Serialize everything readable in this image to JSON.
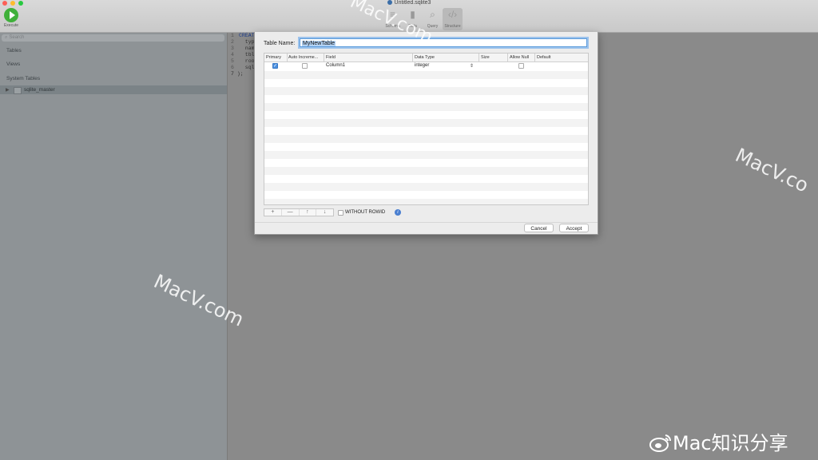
{
  "window": {
    "title": "Untitled.sqlite3"
  },
  "toolbar": {
    "execute_label": "Execute",
    "buttons": [
      {
        "label": "Schema",
        "icon": "schema-icon"
      },
      {
        "label": "Data",
        "icon": "bar-chart-icon"
      },
      {
        "label": "Query",
        "icon": "magnifier-icon"
      },
      {
        "label": "Structure",
        "icon": "code-brackets-icon"
      }
    ],
    "active": "Structure"
  },
  "sidebar": {
    "search_placeholder": "Search",
    "sections": [
      "Tables",
      "Views",
      "System Tables"
    ],
    "items": [
      {
        "name": "sqlite_master",
        "expanded": false
      }
    ]
  },
  "editor": {
    "lines": [
      {
        "n": "1",
        "text": "CREAT"
      },
      {
        "n": "2",
        "text": "  typ"
      },
      {
        "n": "3",
        "text": "  nam"
      },
      {
        "n": "4",
        "text": "  tbl"
      },
      {
        "n": "5",
        "text": "  roo"
      },
      {
        "n": "6",
        "text": "  sql"
      },
      {
        "n": "7",
        "text": ");"
      }
    ]
  },
  "dialog": {
    "table_name_label": "Table Name:",
    "table_name_value": "MyNewTable",
    "columns": [
      "Primary",
      "Auto Increme...",
      "Field",
      "Data Type",
      "Size",
      "Allow Null",
      "Default"
    ],
    "rows": [
      {
        "primary": true,
        "auto_increment": false,
        "field": "Column1",
        "data_type": "integer",
        "size": "",
        "allow_null": false,
        "default": ""
      }
    ],
    "toolbar_buttons": [
      "+",
      "—",
      "↑",
      "↓"
    ],
    "without_rowid_label": "WITHOUT ROWID",
    "without_rowid_checked": false,
    "info_glyph": "i",
    "cancel_label": "Cancel",
    "accept_label": "Accept"
  },
  "watermarks": [
    "MacV.com",
    "MacV.com",
    "MacV.co"
  ],
  "weibo_text": "Mac知识分享",
  "colors": {
    "accent": "#4a8fe0",
    "execute_green": "#3fb03a"
  }
}
